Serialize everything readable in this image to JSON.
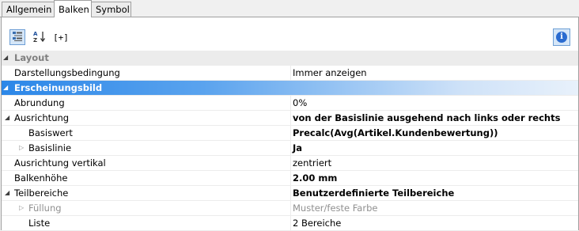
{
  "tabs": [
    "Allgemein",
    "Balken",
    "Symbol"
  ],
  "active_tab": "Balken",
  "toolbar": {
    "categorized_icon": "categorized-view-icon",
    "alpha_icon": "sort-az-icon",
    "formula_label": "[+]",
    "info_label": "i"
  },
  "properties": {
    "layout": {
      "label": "Layout",
      "darstellungsbedingung": {
        "name": "Darstellungsbedingung",
        "value": "Immer anzeigen"
      }
    },
    "erscheinungsbild": {
      "label": "Erscheinungsbild",
      "abrundung": {
        "name": "Abrundung",
        "value": "0%"
      },
      "ausrichtung": {
        "name": "Ausrichtung",
        "value": "von der Basislinie ausgehend nach links oder rechts"
      },
      "basiswert": {
        "name": "Basiswert",
        "value": "Precalc(Avg(Artikel.Kundenbewertung))"
      },
      "basislinie": {
        "name": "Basislinie",
        "value": "Ja"
      },
      "ausrichtung_vertikal": {
        "name": "Ausrichtung vertikal",
        "value": "zentriert"
      },
      "balkenhoehe": {
        "name": "Balkenhöhe",
        "value": "2.00 mm"
      },
      "teilbereiche": {
        "name": "Teilbereiche",
        "value": "Benutzerdefinierte Teilbereiche"
      },
      "fuellung": {
        "name": "Füllung",
        "value": "Muster/feste Farbe"
      },
      "liste": {
        "name": "Liste",
        "value": "2 Bereiche"
      }
    }
  }
}
